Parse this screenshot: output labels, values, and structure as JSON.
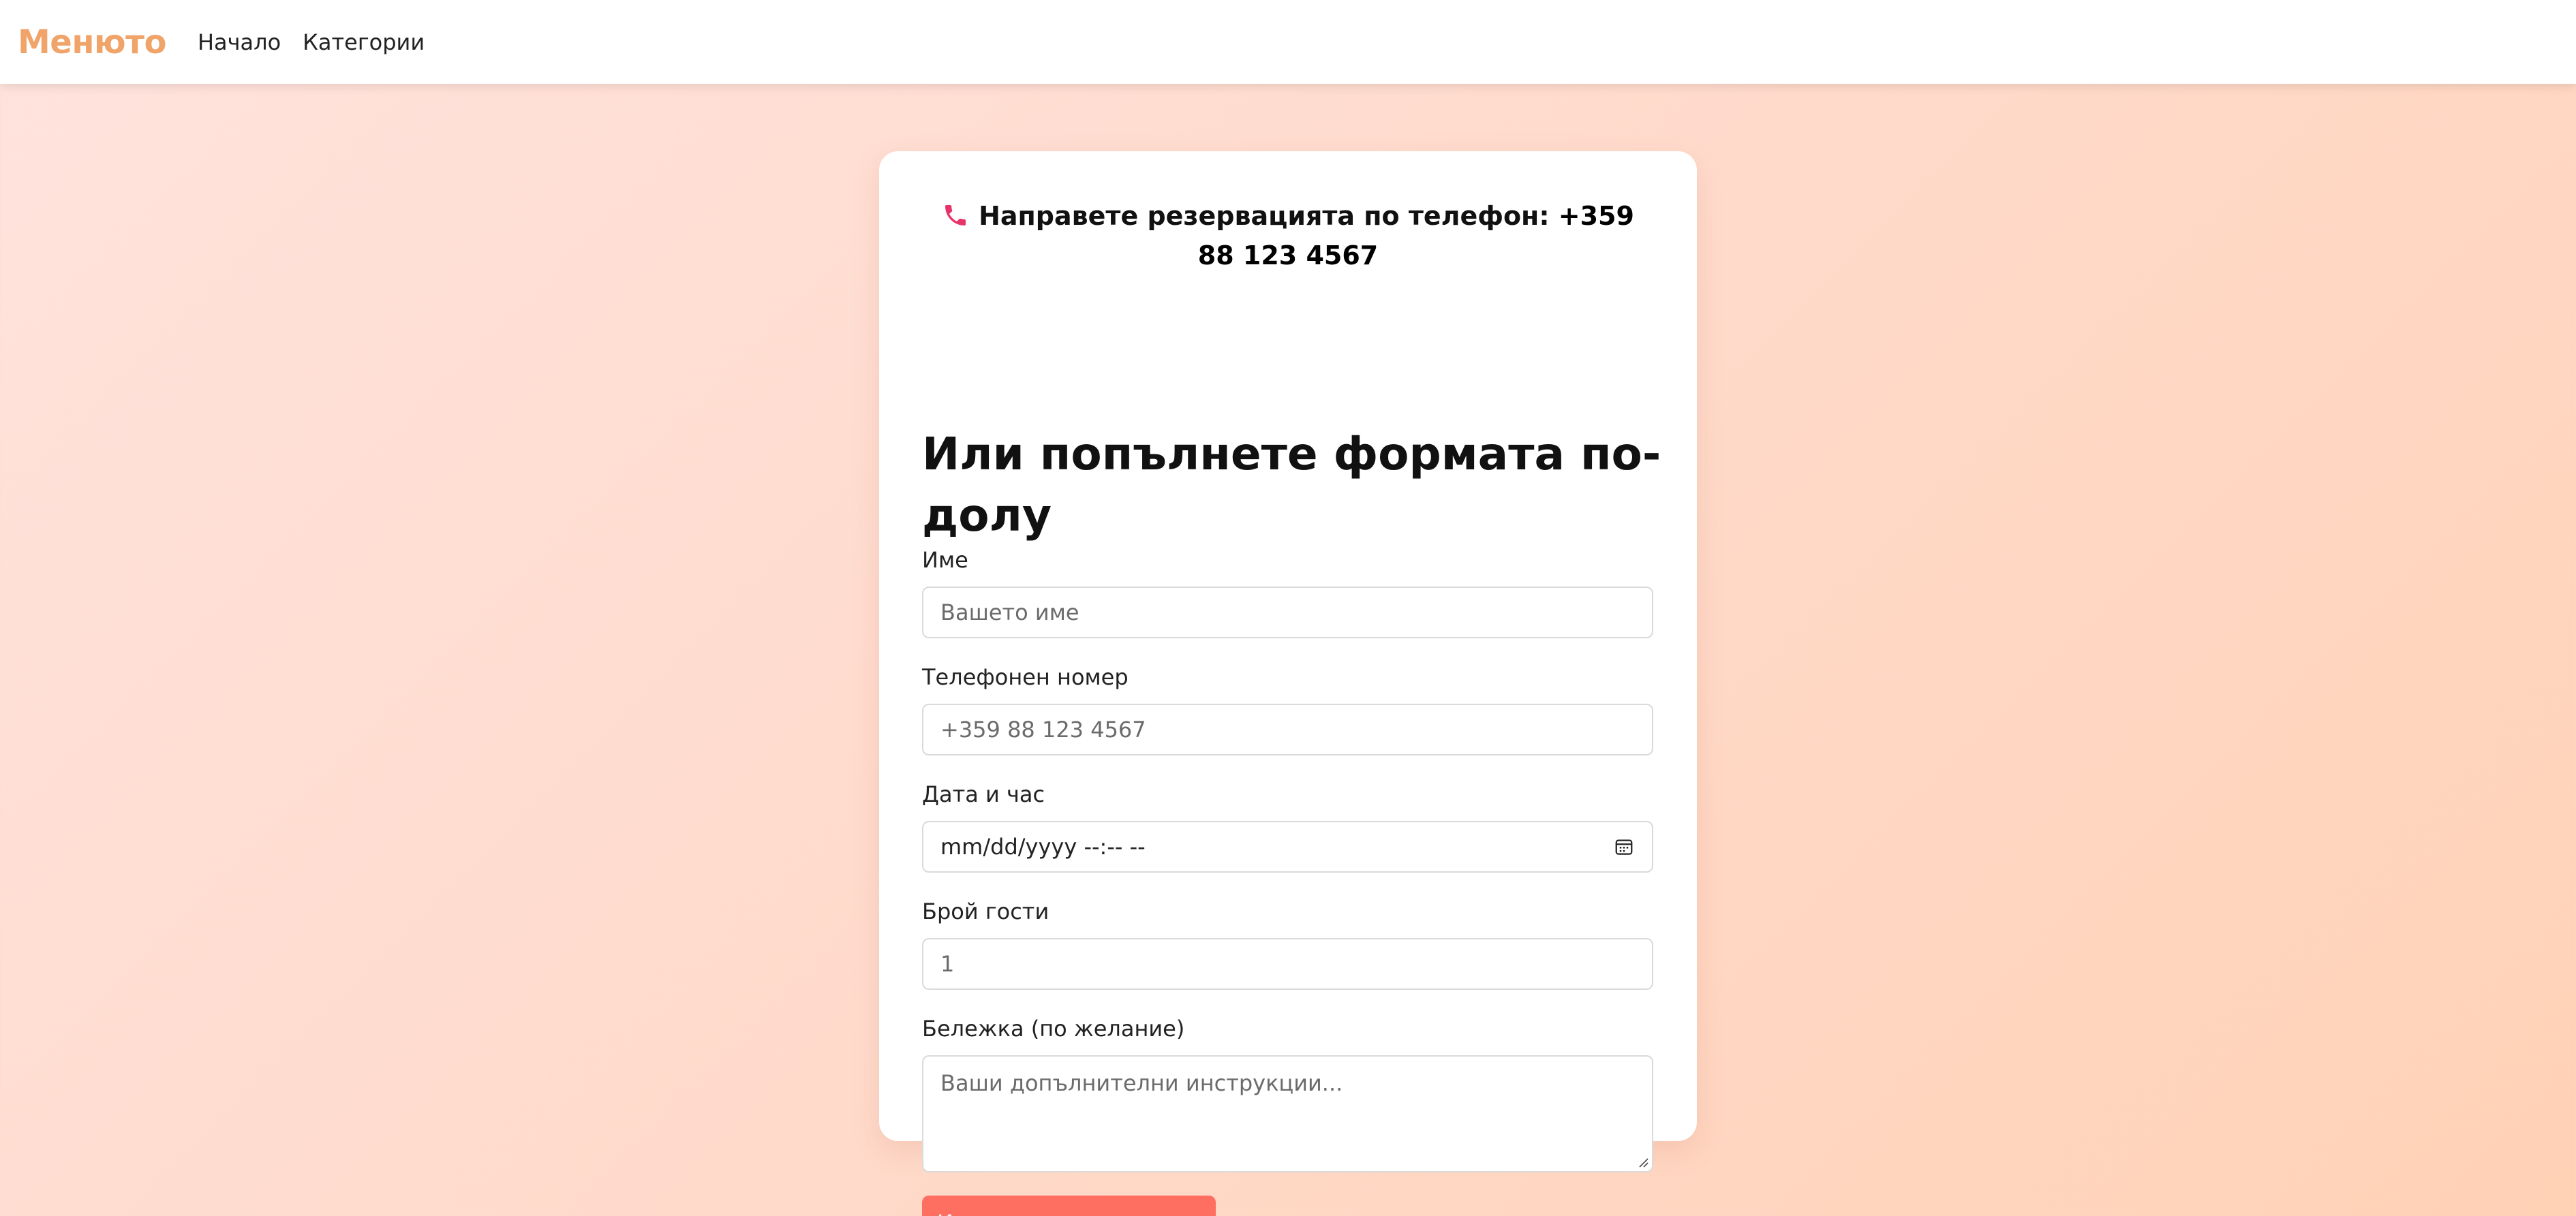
{
  "navbar": {
    "brand": "Менюто",
    "links": [
      "Начало",
      "Категории"
    ]
  },
  "reservation": {
    "phone_prefix": "Направете резервацията по телефон: ",
    "phone_number": "+359 88 123 4567",
    "phone_icon": "phone-icon",
    "heading": "Или попълнете формата по-долу"
  },
  "form": {
    "name": {
      "label": "Име",
      "placeholder": "Вашето име"
    },
    "phone": {
      "label": "Телефонен номер",
      "placeholder": "+359 88 123 4567"
    },
    "datetime": {
      "label": "Дата и час",
      "placeholder": "mm/dd/yyyy --:-- --"
    },
    "guests": {
      "label": "Брой гости",
      "value": "1"
    },
    "note": {
      "label": "Бележка (по желание)",
      "placeholder": "Ваши допълнителни инструкции..."
    },
    "submit_label": "Изпрати резервацията"
  },
  "colors": {
    "brand": "#f0a46a",
    "accent_button": "#ff6f61",
    "phone_icon": "#e8336a"
  }
}
